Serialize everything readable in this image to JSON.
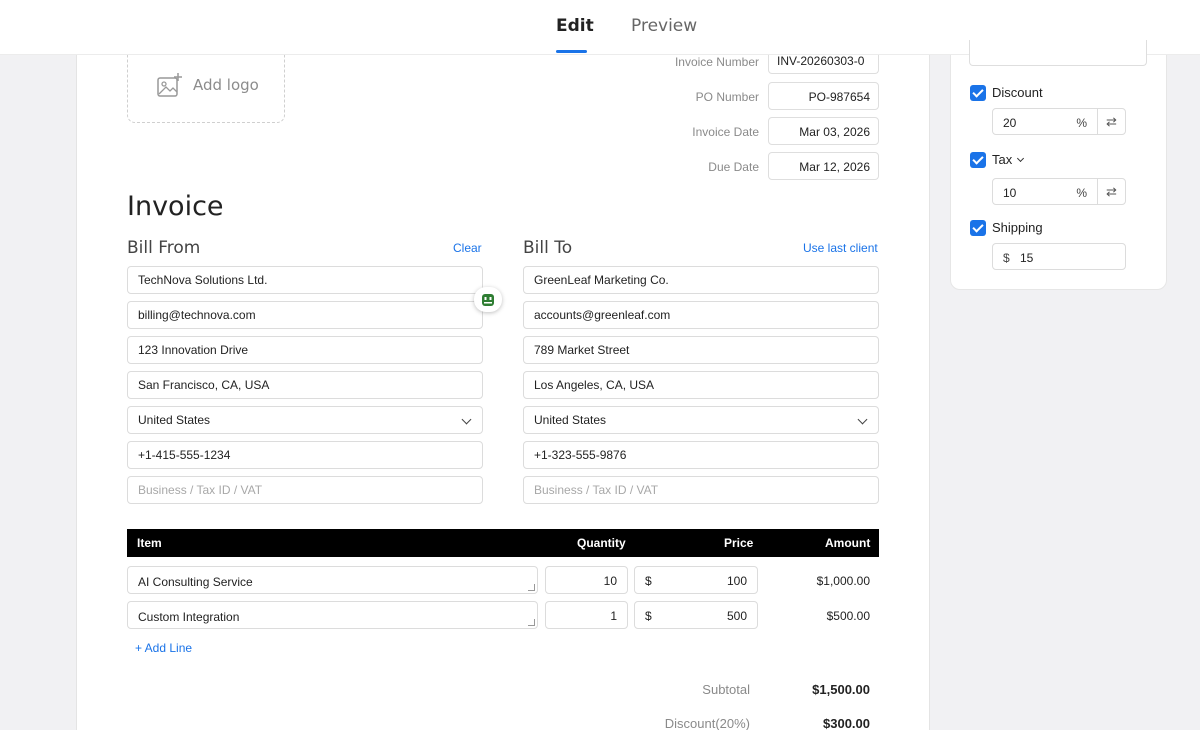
{
  "tabs": {
    "edit": "Edit",
    "preview": "Preview"
  },
  "logo": {
    "add_label": "Add logo"
  },
  "meta": {
    "invoice_number_label": "Invoice Number",
    "invoice_number": "INV-20260303-0",
    "po_number_label": "PO Number",
    "po_number": "PO-987654",
    "invoice_date_label": "Invoice Date",
    "invoice_date": "Mar 03, 2026",
    "due_date_label": "Due Date",
    "due_date": "Mar 12, 2026"
  },
  "title": "Invoice",
  "bill_from": {
    "title": "Bill From",
    "action": "Clear",
    "name": "TechNova Solutions Ltd.",
    "email": "billing@technova.com",
    "address": "123 Innovation Drive",
    "city": "San Francisco, CA, USA",
    "country": "United States",
    "phone": "+1-415-555-1234",
    "tax_placeholder": "Business / Tax ID / VAT"
  },
  "bill_to": {
    "title": "Bill To",
    "action": "Use last client",
    "name": "GreenLeaf Marketing Co.",
    "email": "accounts@greenleaf.com",
    "address": "789 Market Street",
    "city": "Los Angeles, CA, USA",
    "country": "United States",
    "phone": "+1-323-555-9876",
    "tax_placeholder": "Business / Tax ID / VAT"
  },
  "table": {
    "headers": {
      "item": "Item",
      "quantity": "Quantity",
      "price": "Price",
      "amount": "Amount"
    },
    "currency": "$",
    "rows": [
      {
        "item": "AI Consulting Service",
        "quantity": "10",
        "price": "100",
        "amount": "$1,000.00"
      },
      {
        "item": "Custom Integration",
        "quantity": "1",
        "price": "500",
        "amount": "$500.00"
      }
    ],
    "add_line": "+ Add Line"
  },
  "totals": {
    "subtotal_label": "Subtotal",
    "subtotal": "$1,500.00",
    "discount_label": "Discount(20%)",
    "discount": "$300.00"
  },
  "options": {
    "discount": {
      "label": "Discount",
      "checked": true,
      "value": "20",
      "unit": "%"
    },
    "tax": {
      "label": "Tax",
      "checked": true,
      "value": "10",
      "unit": "%"
    },
    "shipping": {
      "label": "Shipping",
      "checked": true,
      "currency": "$",
      "value": "15"
    },
    "swap_glyph": "⇄"
  },
  "colors": {
    "accent": "#1a73e8",
    "table_header": "#000000",
    "background": "#f1f1f3"
  }
}
